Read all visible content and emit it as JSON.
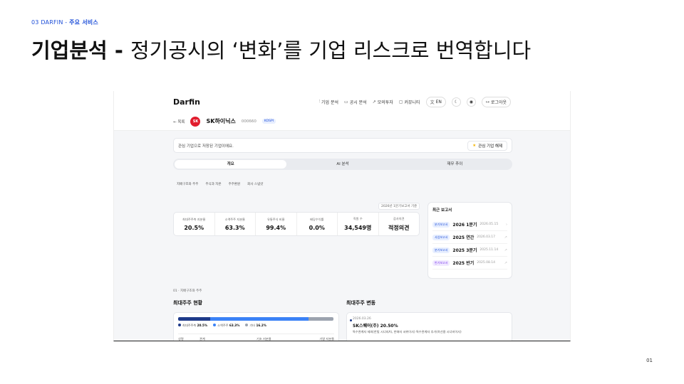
{
  "slide": {
    "eyebrow_prefix": "03 DARFIN - ",
    "eyebrow_bold": "주요 서비스",
    "headline_strong": "기업분석 - ",
    "headline_rest": "정기공시의 ‘변화’를 기업 리스크로 번역합니다",
    "page_number": "01"
  },
  "app": {
    "logo": "Darfin",
    "nav": [
      {
        "icon": "chart-icon",
        "label": "기업 분석"
      },
      {
        "icon": "book-icon",
        "label": "공시 분석"
      },
      {
        "icon": "trend-icon",
        "label": "모의투자"
      },
      {
        "icon": "chat-icon",
        "label": "커뮤니티"
      }
    ],
    "lang_label": "EN",
    "logout_label": "로그아웃",
    "back_label": "← 목록",
    "company": {
      "logo_text": "SK",
      "name": "SK하이닉스",
      "code": "000660",
      "market": "KOSPI"
    },
    "notice": {
      "text": "관심 기업으로 저장된 기업이에요.",
      "button": "관심 기업 해제"
    },
    "tabs": [
      "개요",
      "AI 분석",
      "재무 추이"
    ],
    "subtabs": [
      "지배구조와 주주",
      "주식과 자본",
      "주주환원",
      "회사 스냅샷"
    ],
    "basis_label": "2026년 1분기보고서 기준",
    "metrics": [
      {
        "label": "최대주주측 지분율",
        "value": "20.5%"
      },
      {
        "label": "소액주주 지분율",
        "value": "63.3%"
      },
      {
        "label": "유통주식 비율",
        "value": "99.4%"
      },
      {
        "label": "배당수익률",
        "value": "0.0%"
      },
      {
        "label": "직원 수",
        "value": "34,549명"
      },
      {
        "label": "감사의견",
        "value": "적정의견"
      }
    ],
    "recent_reports": {
      "title": "최근 보고서",
      "items": [
        {
          "type": "분기보고서",
          "period": "2026 1분기",
          "date": "2026.05.15",
          "color": "blue"
        },
        {
          "type": "사업보고서",
          "period": "2025 연간",
          "date": "2026.03.17",
          "color": "blue"
        },
        {
          "type": "분기보고서",
          "period": "2025 3분기",
          "date": "2025.11.14",
          "color": "blue"
        },
        {
          "type": "반기보고서",
          "period": "2025 반기",
          "date": "2025.08.14",
          "color": "purple"
        }
      ]
    },
    "section_label": "01 · 지배구조와 주주",
    "largest_holder": {
      "title": "최대주주 현황",
      "shares": [
        {
          "label": "최대주주측",
          "value": "20.5%",
          "pct": 20.5,
          "color": "#1e3a8a"
        },
        {
          "label": "소액주주",
          "value": "63.3%",
          "pct": 63.3,
          "color": "#3b82f6"
        },
        {
          "label": "기타",
          "value": "16.2%",
          "pct": 16.2,
          "color": "#9ca3af"
        }
      ],
      "table_headers": [
        "성명",
        "관계",
        "기초 지분율",
        "기말 지분율"
      ]
    },
    "holder_change": {
      "title": "최대주주 변동",
      "date": "2026.03.26",
      "name": "SK스퀘어(주)  20.50%",
      "desc": "특수관계자 제외(한빛 시너지A), 한애자 서위이사) 특수관계자 추가(하선웅 시너비이사)"
    }
  }
}
